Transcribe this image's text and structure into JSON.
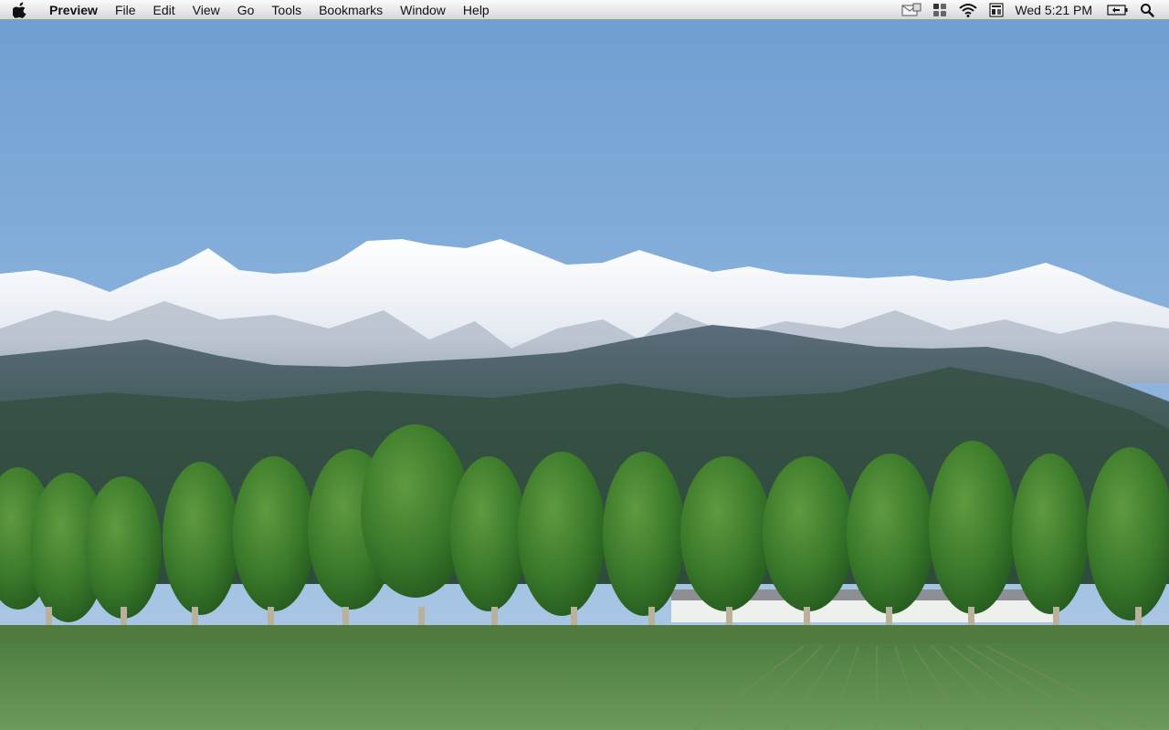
{
  "menubar": {
    "apple_icon": "apple-logo-icon",
    "app_name": "Preview",
    "items": [
      {
        "id": "file",
        "label": "File"
      },
      {
        "id": "edit",
        "label": "Edit"
      },
      {
        "id": "view",
        "label": "View"
      },
      {
        "id": "go",
        "label": "Go"
      },
      {
        "id": "tools",
        "label": "Tools"
      },
      {
        "id": "bookmarks",
        "label": "Bookmarks"
      },
      {
        "id": "window",
        "label": "Window"
      },
      {
        "id": "help",
        "label": "Help"
      }
    ],
    "status": {
      "icons": [
        "mail-status-icon",
        "spaces-icon",
        "wifi-icon",
        "keyboard-viewer-icon",
        "battery-icon",
        "spotlight-search-icon"
      ],
      "clock": "Wed 5:21 PM"
    }
  },
  "desktop": {
    "wallpaper": "Snow-capped mountains behind a row of green trees and a farm field",
    "colors": {
      "sky_top": "#6e9ed1",
      "sky_bottom": "#a9c6e2",
      "snow": "#f4f6f9",
      "hills": "#3e5a52",
      "trees": "#3c7a2c",
      "field": "#58894a"
    }
  }
}
